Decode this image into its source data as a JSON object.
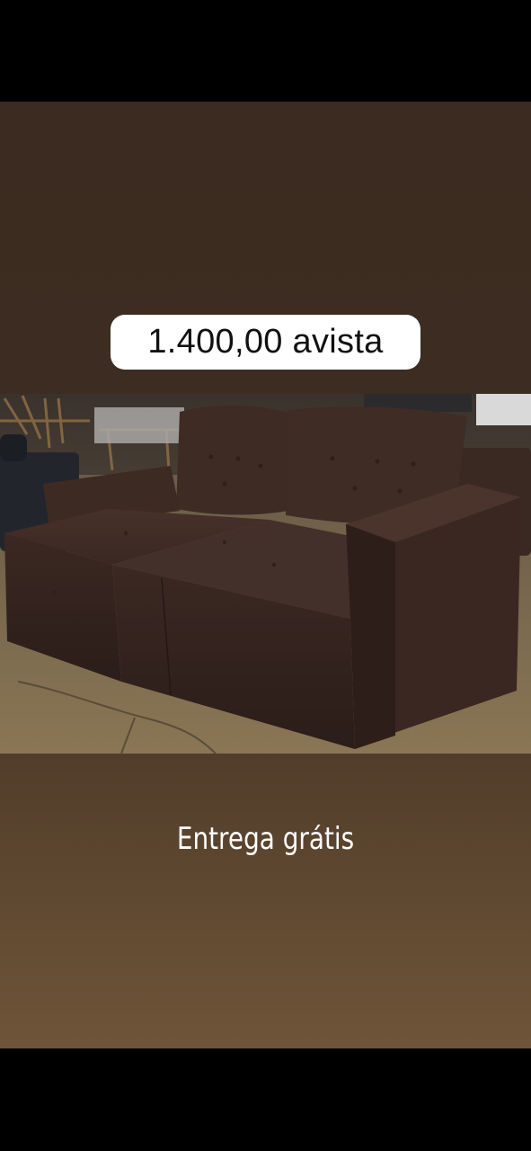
{
  "story": {
    "price_label": "1.400,00 avista",
    "caption": "Entrega grátis",
    "photo_subject": "sofa-image",
    "colors": {
      "background_top": "#3b2b20",
      "background_bottom": "#6f5538",
      "pill": "#ffffff",
      "price_text": "#111111",
      "caption_text": "#ffffff",
      "sofa": "#3a2720"
    }
  }
}
